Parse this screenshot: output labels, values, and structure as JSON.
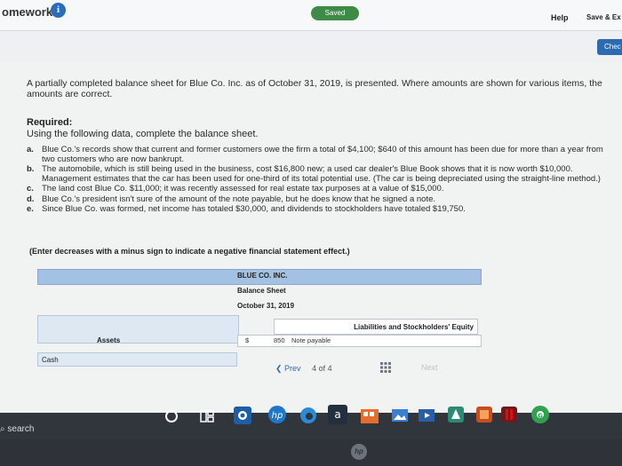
{
  "topbar": {
    "title": "omework",
    "info_icon": "i",
    "saved_label": "Saved",
    "help_label": "Help",
    "save_exit_label": "Save & Ex",
    "check_label": "Chec"
  },
  "question": {
    "intro": "A partially completed balance sheet for Blue Co. Inc. as of October 31, 2019, is presented. Where amounts are shown for various items, the amounts are correct.",
    "required_title": "Required:",
    "required_text": "Using the following data, complete the balance sheet.",
    "items": [
      {
        "mark": "a.",
        "text": "Blue Co.'s records show that current and former customers owe the firm a total of $4,100; $640 of this amount has been due for more than a year from two customers who are now bankrupt."
      },
      {
        "mark": "b.",
        "text": "The automobile, which is still being used in the business, cost $16,800 new; a used car dealer's Blue Book shows that it is now worth $10,000. Management estimates that the car has been used for one-third of its total potential use. (The car is being depreciated using the straight-line method.)"
      },
      {
        "mark": "c.",
        "text": "The land cost Blue Co. $11,000; it was recently assessed for real estate tax purposes at a value of $15,000."
      },
      {
        "mark": "d.",
        "text": "Blue Co.'s president isn't sure of the amount of the note payable, but he does know that he signed a note."
      },
      {
        "mark": "e.",
        "text": "Since Blue Co. was formed, net income has totaled $30,000, and dividends to stockholders have totaled $19,750."
      }
    ],
    "note": "(Enter decreases with a minus sign to indicate a negative financial statement effect.)"
  },
  "balance_sheet": {
    "company": "BLUE CO. INC.",
    "title": "Balance Sheet",
    "date": "October 31, 2019",
    "assets_label": "Assets",
    "liab_label": "Liabilities and Stockholders' Equity",
    "currency": "$",
    "note_amount": "850",
    "note_label": "Note payable",
    "cash_label": "Cash"
  },
  "pager": {
    "prev_label": "Prev",
    "page_num": "4",
    "of_label": "of",
    "page_total": "4",
    "next_label": "Next"
  },
  "taskbar": {
    "search_label": "search",
    "mail_label": "a"
  },
  "colors": {
    "accent": "#2d6bb0",
    "saved_green": "#3e8b48",
    "table_header": "#a3c2e3"
  }
}
